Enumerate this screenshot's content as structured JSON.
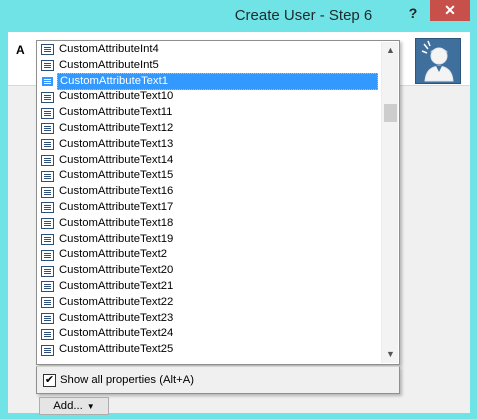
{
  "window": {
    "title": "Create User - Step 6",
    "help_label": "?",
    "close_label": "✕"
  },
  "header": {
    "label_fragment": "A",
    "icon": "user-account-icon"
  },
  "listbox": {
    "items": [
      {
        "label": "CustomAttributeInt4",
        "icon": "property-icon"
      },
      {
        "label": "CustomAttributeInt5",
        "icon": "property-icon"
      },
      {
        "label": "CustomAttributeText1",
        "icon": "property-icon",
        "selected": true
      },
      {
        "label": "CustomAttributeText10",
        "icon": "property-icon"
      },
      {
        "label": "CustomAttributeText11",
        "icon": "property-icon"
      },
      {
        "label": "CustomAttributeText12",
        "icon": "property-icon"
      },
      {
        "label": "CustomAttributeText13",
        "icon": "property-icon"
      },
      {
        "label": "CustomAttributeText14",
        "icon": "property-icon"
      },
      {
        "label": "CustomAttributeText15",
        "icon": "property-icon"
      },
      {
        "label": "CustomAttributeText16",
        "icon": "property-icon"
      },
      {
        "label": "CustomAttributeText17",
        "icon": "property-icon"
      },
      {
        "label": "CustomAttributeText18",
        "icon": "property-icon"
      },
      {
        "label": "CustomAttributeText19",
        "icon": "property-icon"
      },
      {
        "label": "CustomAttributeText2",
        "icon": "property-icon"
      },
      {
        "label": "CustomAttributeText20",
        "icon": "property-icon"
      },
      {
        "label": "CustomAttributeText21",
        "icon": "property-icon"
      },
      {
        "label": "CustomAttributeText22",
        "icon": "property-icon"
      },
      {
        "label": "CustomAttributeText23",
        "icon": "property-icon"
      },
      {
        "label": "CustomAttributeText24",
        "icon": "property-icon"
      },
      {
        "label": "CustomAttributeText25",
        "icon": "property-icon"
      }
    ],
    "selected_color": "#3399ff"
  },
  "scrollbar": {
    "up_label": "▲",
    "down_label": "▼"
  },
  "footer": {
    "show_all_checked": true,
    "check_mark": "✔",
    "show_all_label": "Show all properties (Alt+A)"
  },
  "add_button": {
    "label": "Add...",
    "caret": "▼"
  }
}
